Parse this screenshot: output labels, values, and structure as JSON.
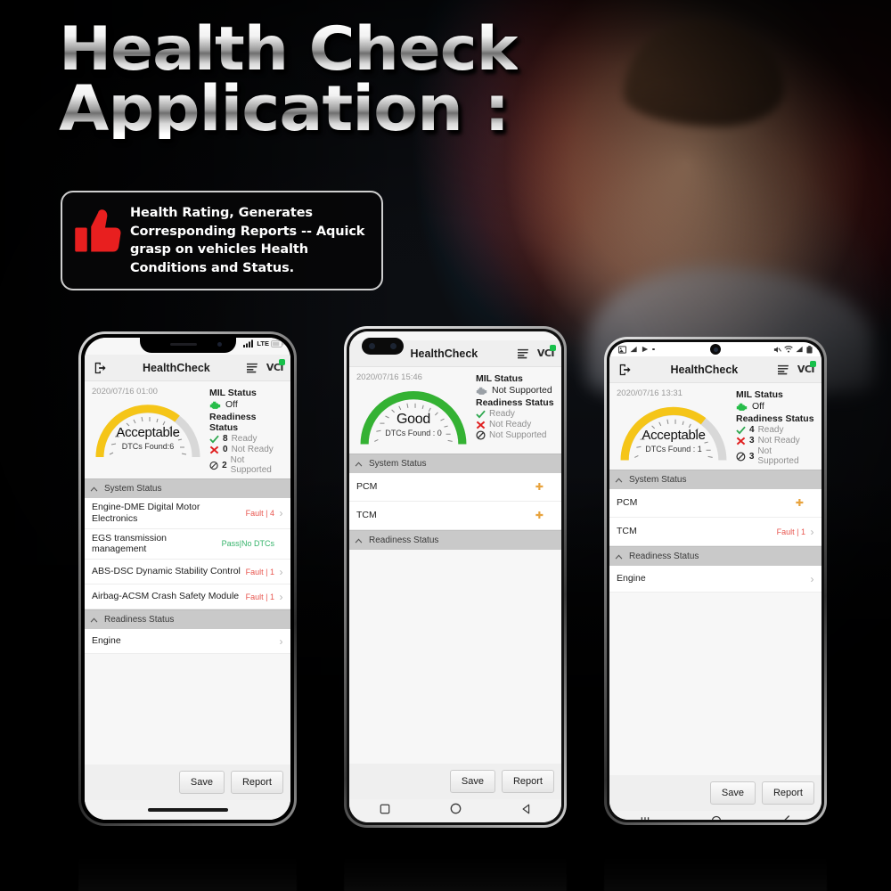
{
  "headline": {
    "line1": "Health Check",
    "line2": "Application :"
  },
  "callout": {
    "icon": "thumbs-up-icon",
    "text": "Health Rating,  Generates Corresponding Reports -- Aquick grasp on vehicles Health Conditions and Status."
  },
  "app": {
    "title": "HealthCheck",
    "exit_icon": "exit-icon",
    "report_icon": "report-list-icon",
    "vci_label": "VCI",
    "section_system": "System Status",
    "section_readiness": "Readiness Status",
    "mil_heading": "MIL Status",
    "readiness_heading": "Readiness Status",
    "save_label": "Save",
    "report_label": "Report"
  },
  "colors": {
    "fault": "#e8554e",
    "pass": "#35b36a",
    "gauge_yellow": "#f5c518",
    "gauge_green": "#34b233",
    "gauge_track": "#d8d8d8",
    "loading": "#e8a33d",
    "accent_green": "#17c04a"
  },
  "phones": [
    {
      "id": "phone-iphone",
      "frame": "iphone-notch",
      "status_bar": {
        "network": "LTE",
        "signal_icon": "signal-bars-icon",
        "battery_icon": "battery-icon"
      },
      "date": "2020/07/16 01:00",
      "gauge": {
        "rating": "Acceptable",
        "dtcs_text": "DTCs Found:6",
        "color": "#f5c518",
        "fill_pct": 66
      },
      "mil": {
        "heading": "MIL Status",
        "value": "Off",
        "icon": "engine-icon"
      },
      "readiness": {
        "heading": "Readiness Status",
        "items": [
          {
            "icon": "check-icon",
            "count": "8",
            "label": "Ready"
          },
          {
            "icon": "cross-icon",
            "count": "0",
            "label": "Not Ready"
          },
          {
            "icon": "not-supported-icon",
            "count": "2",
            "label": "Not Supported"
          }
        ]
      },
      "system_rows": [
        {
          "name": "Engine-DME Digital Motor Electronics",
          "status": "Fault | 4",
          "status_type": "fault",
          "chevron": true
        },
        {
          "name": "EGS transmission management",
          "status": "Pass|No DTCs",
          "status_type": "pass",
          "chevron": false
        },
        {
          "name": "ABS-DSC Dynamic Stability Control",
          "status": "Fault | 1",
          "status_type": "fault",
          "chevron": true
        },
        {
          "name": "Airbag-ACSM Crash Safety Module",
          "status": "Fault | 1",
          "status_type": "fault",
          "chevron": true
        }
      ],
      "readiness_rows": [
        {
          "name": "Engine",
          "status": "",
          "status_type": "none",
          "chevron": true
        }
      ],
      "nav": {
        "type": "home-indicator",
        "buttons": []
      }
    },
    {
      "id": "phone-huawei",
      "frame": "punch-hole-dual",
      "status_bar": {},
      "date": "2020/07/16 15:46",
      "gauge": {
        "rating": "Good",
        "dtcs_text": "DTCs Found : 0",
        "color": "#34b233",
        "fill_pct": 100
      },
      "mil": {
        "heading": "MIL Status",
        "value": "Not Supported",
        "icon": "engine-icon"
      },
      "readiness": {
        "heading": "Readiness Status",
        "items": [
          {
            "icon": "check-icon",
            "count": "",
            "label": "Ready"
          },
          {
            "icon": "cross-icon",
            "count": "",
            "label": "Not Ready"
          },
          {
            "icon": "not-supported-icon",
            "count": "",
            "label": "Not Supported"
          }
        ]
      },
      "system_rows": [
        {
          "name": "PCM",
          "status": "",
          "status_type": "loading",
          "chevron": false
        },
        {
          "name": "TCM",
          "status": "",
          "status_type": "loading",
          "chevron": false
        }
      ],
      "readiness_rows": [],
      "nav": {
        "type": "android-3button",
        "buttons": [
          "recents-square-icon",
          "home-circle-icon",
          "back-triangle-icon"
        ]
      }
    },
    {
      "id": "phone-samsung",
      "frame": "punch-hole-center",
      "status_bar": {
        "left_icons": [
          "image-icon",
          "signal-icon",
          "play-icon",
          "dot-icon"
        ],
        "right_icons": [
          "mute-icon",
          "wifi-icon",
          "signal-bars-icon",
          "battery-icon"
        ]
      },
      "date": "2020/07/16 13:31",
      "gauge": {
        "rating": "Acceptable",
        "dtcs_text": "DTCs Found : 1",
        "color": "#f5c518",
        "fill_pct": 66
      },
      "mil": {
        "heading": "MIL Status",
        "value": "Off",
        "icon": "engine-icon"
      },
      "readiness": {
        "heading": "Readiness Status",
        "items": [
          {
            "icon": "check-icon",
            "count": "4",
            "label": "Ready"
          },
          {
            "icon": "cross-icon",
            "count": "3",
            "label": "Not Ready"
          },
          {
            "icon": "not-supported-icon",
            "count": "3",
            "label": "Not Supported"
          }
        ]
      },
      "system_rows": [
        {
          "name": "PCM",
          "status": "",
          "status_type": "loading",
          "chevron": false
        },
        {
          "name": "TCM",
          "status": "Fault | 1",
          "status_type": "fault",
          "chevron": true
        }
      ],
      "readiness_rows": [
        {
          "name": "Engine",
          "status": "",
          "status_type": "none",
          "chevron": true
        }
      ],
      "nav": {
        "type": "samsung-3button",
        "buttons": [
          "recents-lines-icon",
          "home-circle-icon",
          "back-chevron-icon"
        ]
      }
    }
  ]
}
